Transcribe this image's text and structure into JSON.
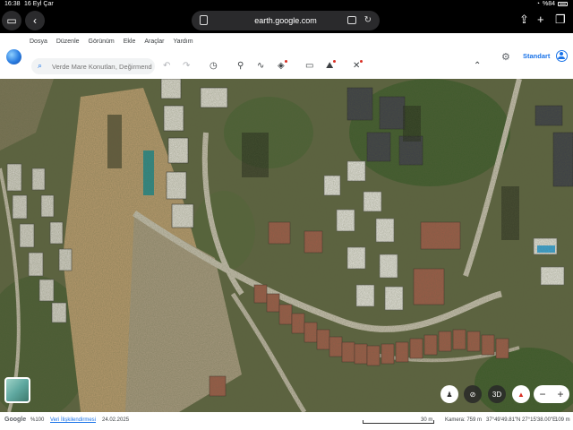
{
  "status_bar": {
    "time": "16:38",
    "date": "16 Eyl Çar",
    "battery": "%84"
  },
  "browser": {
    "url": "earth.google.com"
  },
  "menu": [
    "Dosya",
    "Düzenle",
    "Görünüm",
    "Ekle",
    "Araçlar",
    "Yardım"
  ],
  "search": {
    "placeholder": "Verde Mare Konutları, Değirmendere"
  },
  "header_right": {
    "mode_label": "Standart"
  },
  "map_controls": {
    "three_d_label": "3D"
  },
  "footer": {
    "brand": "Google",
    "zoom_pct": "%100",
    "data_attribution": "Veri İlişkilendirmesi",
    "imagery_date": "24.02.2025",
    "scale_label": "30 m",
    "camera": "Kamera: 759 m",
    "coordinates": "37°49'49.81\"N 27°15'38.00\"E",
    "elevation": "109 m"
  },
  "colors": {
    "accent": "#1a73e8",
    "alert_dot": "#d93025"
  },
  "icons": {
    "sidebar": "sidebar-toggle-icon",
    "back": "back-chevron-icon",
    "share": "share-icon",
    "new_tab": "plus-icon",
    "tabs": "tabs-overview-icon",
    "search": "search-icon",
    "undo": "undo-icon",
    "redo": "redo-icon",
    "history": "history-icon",
    "placemark": "placemark-icon",
    "path": "path-icon",
    "layers": "layers-icon",
    "ruler": "ruler-icon",
    "image": "image-overlay-icon",
    "satellite": "satellite-icon",
    "collapse": "chevron-up-icon",
    "settings": "gear-icon",
    "account": "account-icon",
    "pegman": "pegman-icon",
    "no_location": "location-off-icon",
    "compass": "compass-icon"
  }
}
